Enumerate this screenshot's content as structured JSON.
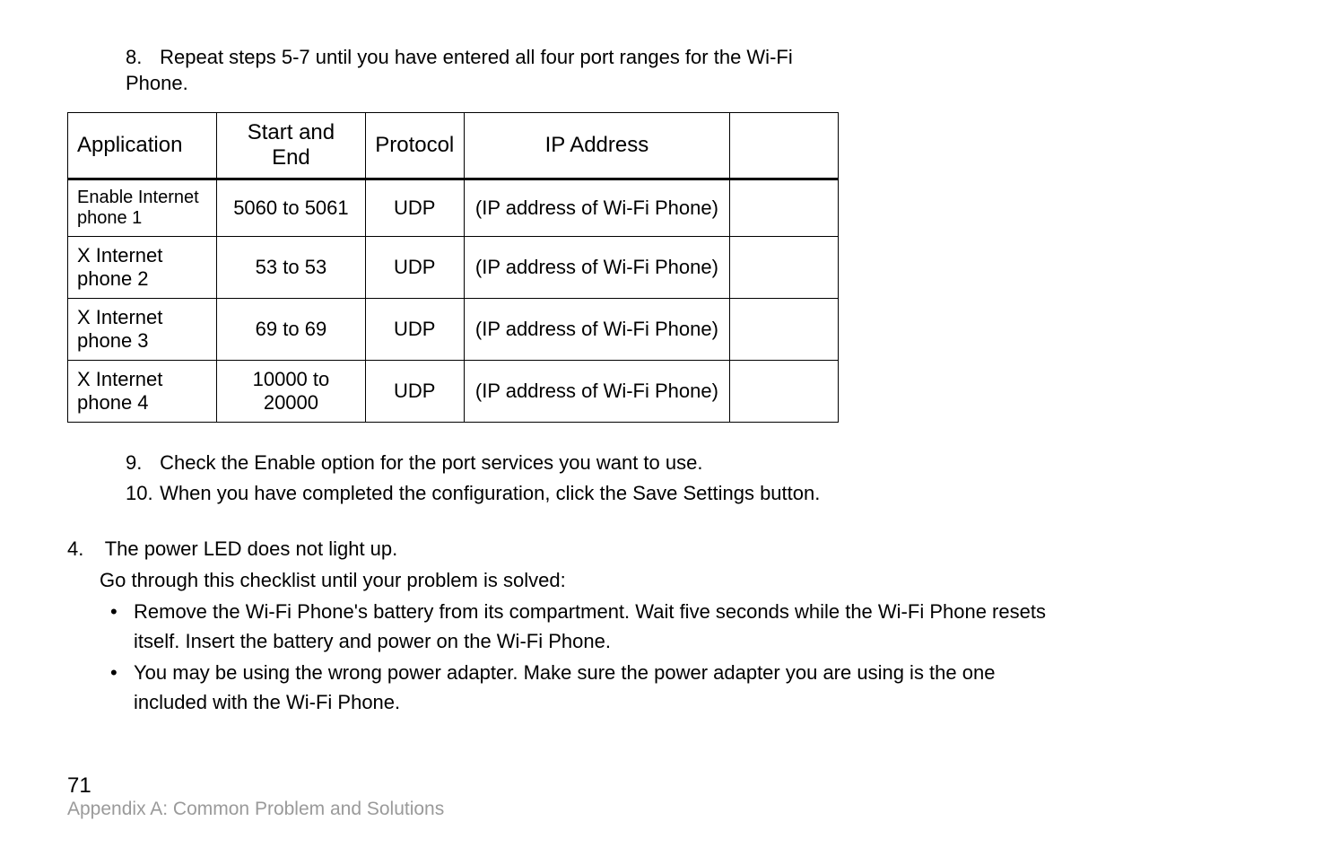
{
  "intro_step": {
    "num": "8.",
    "text_a": "Repeat steps 5-7 until you have entered all four port ranges for the Wi-Fi",
    "text_b": "Phone."
  },
  "table": {
    "headers": {
      "application": "Application",
      "start_end": "Start and End",
      "protocol": "Protocol",
      "ip": "IP Address"
    },
    "rows": [
      {
        "app": "Enable Internet phone 1",
        "se": "5060 to 5061",
        "proto": "UDP",
        "ip": "(IP address of Wi-Fi Phone)"
      },
      {
        "app": "X Internet phone 2",
        "se": "53 to 53",
        "proto": "UDP",
        "ip": "(IP address of Wi-Fi Phone)"
      },
      {
        "app": "X Internet phone 3",
        "se": "69 to 69",
        "proto": "UDP",
        "ip": "(IP address of Wi-Fi Phone)"
      },
      {
        "app": "X Internet phone 4",
        "se": "10000 to 20000",
        "proto": "UDP",
        "ip": "(IP address of Wi-Fi Phone)"
      }
    ]
  },
  "after_steps": [
    {
      "num": "9.",
      "text": "Check the Enable option for the port services you want to use."
    },
    {
      "num": "10.",
      "text": "When you have completed the configuration, click the Save Settings button."
    }
  ],
  "q4": {
    "num": "4.",
    "title": "The power LED does not light up.",
    "sub": "Go through this checklist until your problem is solved:",
    "bullets": [
      {
        "line1": "Remove the Wi-Fi Phone's battery from its compartment. Wait five seconds while the Wi-Fi Phone resets",
        "line2": "itself. Insert the battery and power on the Wi-Fi Phone."
      },
      {
        "line1": "You may be using the wrong power adapter. Make sure the power adapter you are using is the one",
        "line2": "included with the Wi-Fi Phone."
      }
    ]
  },
  "footer": {
    "page": "71",
    "appendix": "Appendix A: Common Problem and Solutions"
  },
  "chart_data": {
    "type": "table",
    "title": "Port range forwarding for Wi-Fi Phone",
    "columns": [
      "Application",
      "Start and End",
      "Protocol",
      "IP Address"
    ],
    "rows": [
      [
        "Enable Internet phone 1",
        "5060 to 5061",
        "UDP",
        "(IP address of Wi-Fi Phone)"
      ],
      [
        "X Internet phone 2",
        "53 to 53",
        "UDP",
        "(IP address of Wi-Fi Phone)"
      ],
      [
        "X Internet phone 3",
        "69 to 69",
        "UDP",
        "(IP address of Wi-Fi Phone)"
      ],
      [
        "X Internet phone 4",
        "10000 to 20000",
        "UDP",
        "(IP address of Wi-Fi Phone)"
      ]
    ]
  }
}
